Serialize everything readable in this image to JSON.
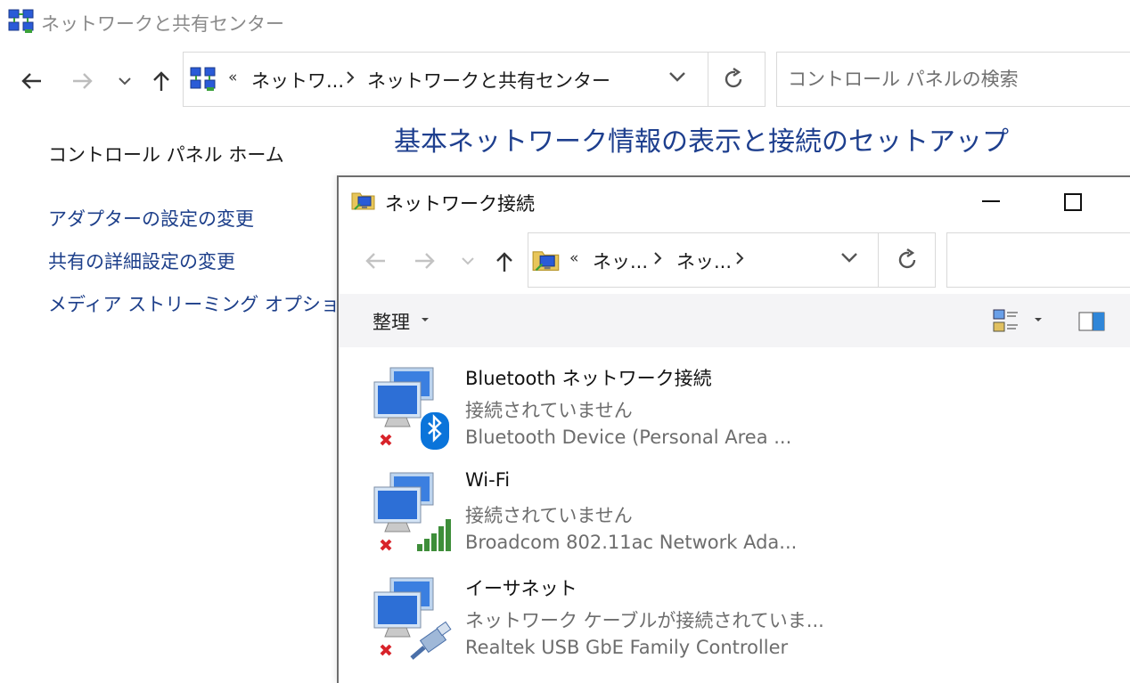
{
  "bg_window": {
    "title": "ネットワークと共有センター",
    "address": {
      "overflow": "«",
      "crumbs": [
        "ネットワ...",
        "ネットワークと共有センター"
      ]
    },
    "search_placeholder": "コントロール パネルの検索",
    "heading": "基本ネットワーク情報の表示と接続のセットアップ",
    "sidebar": {
      "home": "コントロール パネル ホーム",
      "links": [
        "アダプターの設定の変更",
        "共有の詳細設定の変更",
        "メディア ストリーミング オプション"
      ]
    }
  },
  "fg_window": {
    "title": "ネットワーク接続",
    "address": {
      "overflow": "«",
      "crumbs": [
        "ネッ...",
        "ネッ..."
      ]
    },
    "toolbar": {
      "organize": "整理"
    },
    "connections": [
      {
        "name": "Bluetooth ネットワーク接続",
        "status": "接続されていません",
        "device": "Bluetooth Device (Personal Area ...",
        "badge": "bluetooth-icon"
      },
      {
        "name": "Wi-Fi",
        "status": "接続されていません",
        "device": "Broadcom 802.11ac Network Ada...",
        "badge": "wifi-signal-icon"
      },
      {
        "name": "イーサネット",
        "status": "ネットワーク ケーブルが接続されていま...",
        "device": "Realtek USB GbE Family Controller",
        "badge": "ethernet-cable-icon"
      }
    ]
  },
  "colors": {
    "heading": "#1e3f8e",
    "link": "#1d3f8a",
    "secondary_text": "#6d6d6d",
    "error_x": "#d8232a",
    "bluetooth": "#0a74da",
    "wifi_bars": "#3e8e3a"
  }
}
